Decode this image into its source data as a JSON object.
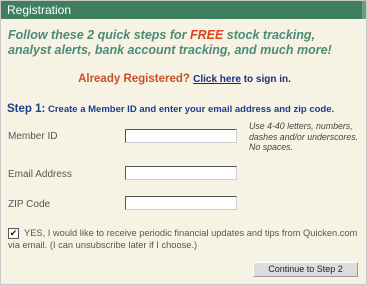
{
  "header": {
    "title": "Registration"
  },
  "promo": {
    "before": "Follow these 2 quick steps for ",
    "free": "FREE",
    "after": " stock tracking, analyst alerts, bank account tracking, and much more!"
  },
  "already": {
    "prefix": "Already Registered? ",
    "link": "Click here",
    "suffix": " to sign in."
  },
  "step": {
    "number": "Step 1:",
    "instruction": " Create a Member ID and enter your email address and zip code."
  },
  "form": {
    "member_id_label": "Member ID",
    "member_id_value": "",
    "email_label": "Email Address",
    "email_value": "",
    "zip_label": "ZIP Code",
    "zip_value": "",
    "hint": "Use 4-40 letters, numbers, dashes and/or underscores. No spaces."
  },
  "consent": {
    "checked": true,
    "mark": "✔",
    "text": "YES, I would like to receive periodic financial updates and tips from Quicken.com via email. (I can unsubscribe later if I choose.)"
  },
  "continue_button": {
    "label": "Continue to Step 2"
  },
  "colors": {
    "header_bg": "#3f7f5f",
    "panel_bg": "#f7f3e4",
    "promo_text": "#4b8a74",
    "free_text": "#e2431a",
    "step_text": "#1d3d8c"
  }
}
